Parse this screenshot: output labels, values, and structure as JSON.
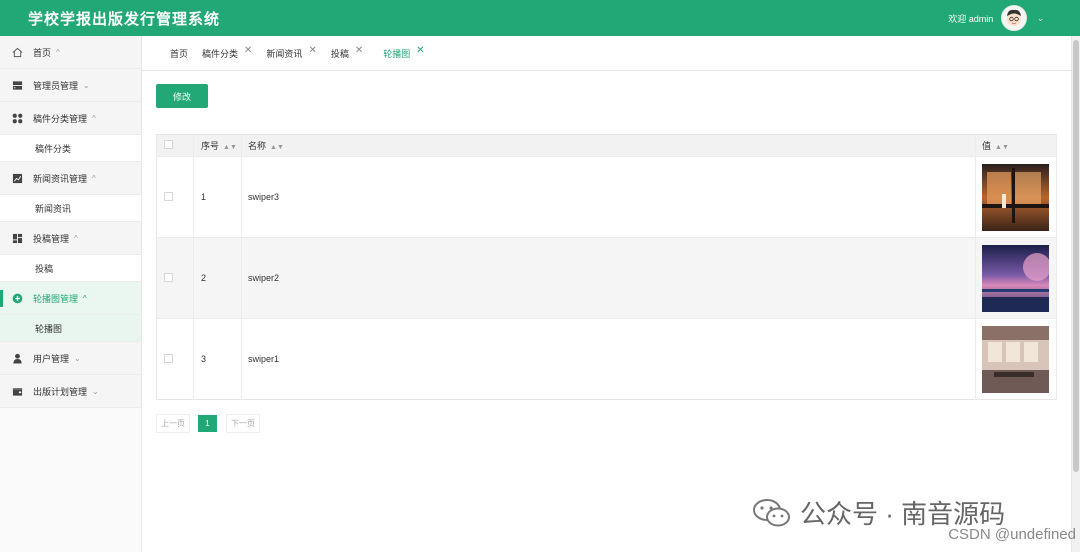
{
  "header": {
    "title": "学校学报出版发行管理系统",
    "welcome": "欢迎 admin",
    "accent_color": "#21a876"
  },
  "sidebar": {
    "items": [
      {
        "label": "首页",
        "icon": "home-icon"
      },
      {
        "label": "管理员管理",
        "icon": "server-icon"
      },
      {
        "label": "稿件分类管理",
        "icon": "grid-icon",
        "sub": "稿件分类"
      },
      {
        "label": "新闻资讯管理",
        "icon": "chart-icon",
        "sub": "新闻资讯"
      },
      {
        "label": "投稿管理",
        "icon": "dashboard-icon",
        "sub": "投稿"
      },
      {
        "label": "轮播图管理",
        "icon": "plus-circle-icon",
        "sub": "轮播图"
      },
      {
        "label": "用户管理",
        "icon": "user-icon"
      },
      {
        "label": "出版计划管理",
        "icon": "wallet-icon"
      }
    ]
  },
  "tabs": [
    {
      "label": "首页"
    },
    {
      "label": "稿件分类",
      "close": "✕"
    },
    {
      "label": "新闻资讯",
      "close": "✕"
    },
    {
      "label": "投稿",
      "close": "✕"
    },
    {
      "label": "轮播图",
      "close": "✕"
    }
  ],
  "toolbar": {
    "edit_label": "修改"
  },
  "table": {
    "headers": {
      "index": "序号",
      "name": "名称",
      "value": "值"
    },
    "rows": [
      {
        "index": "1",
        "name": "swiper3"
      },
      {
        "index": "2",
        "name": "swiper2"
      },
      {
        "index": "3",
        "name": "swiper1"
      }
    ]
  },
  "pagination": {
    "prev": "上一页",
    "current": "1",
    "next": "下一页"
  },
  "watermark": {
    "text": "公众号 · 南音源码",
    "csdn": "CSDN @undefined"
  }
}
